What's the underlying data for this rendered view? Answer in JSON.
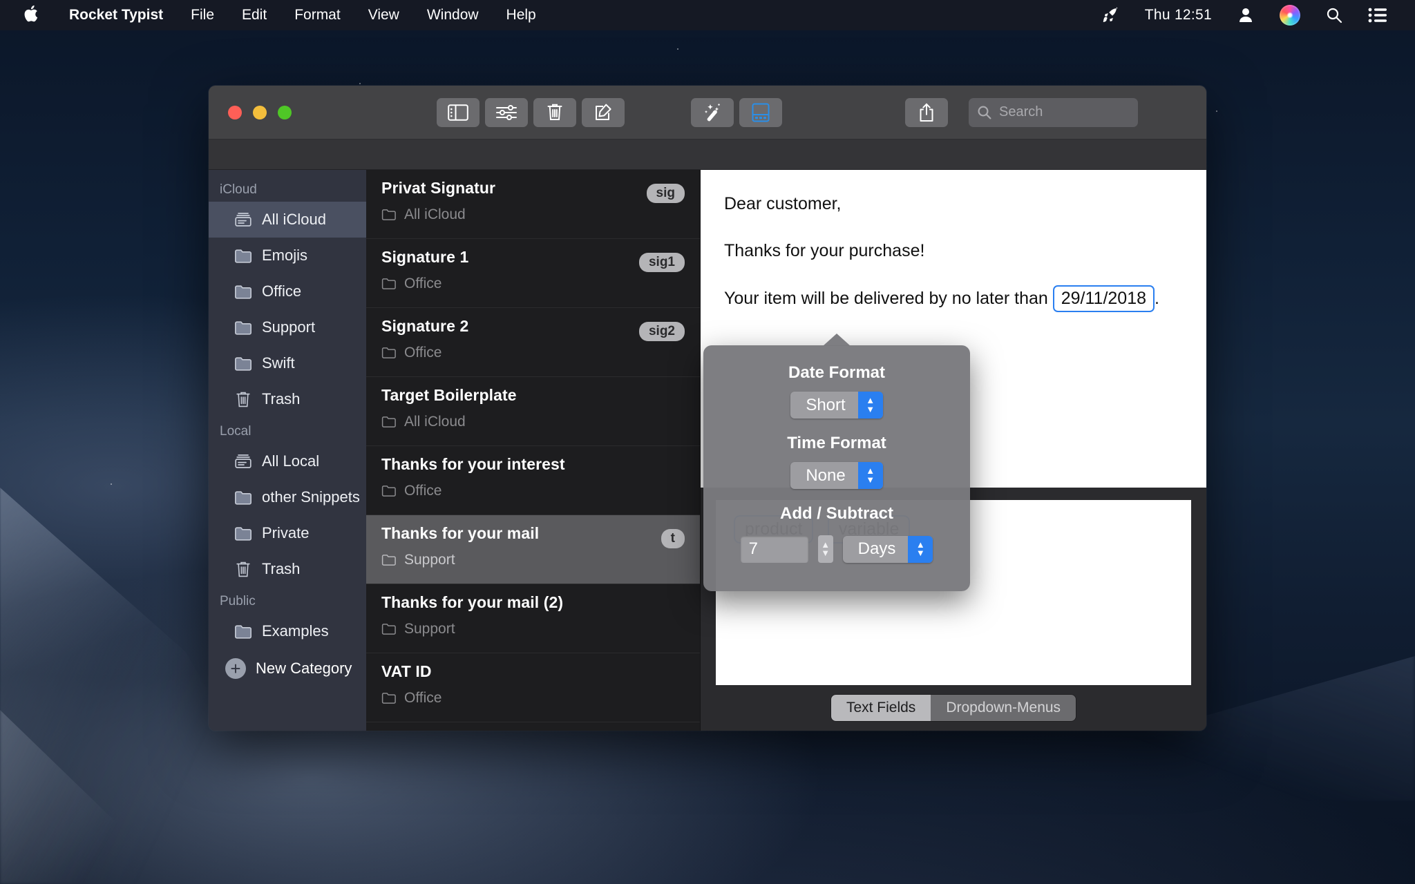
{
  "menubar": {
    "apple_icon": "apple-logo-icon",
    "app_name": "Rocket Typist",
    "items": [
      "File",
      "Edit",
      "Format",
      "View",
      "Window",
      "Help"
    ],
    "status": {
      "rocket_icon": "rocket-icon",
      "clock": "Thu 12:51",
      "user_icon": "user-account-icon",
      "siri_icon": "siri-icon",
      "search_icon": "spotlight-search-icon",
      "control_center_icon": "control-center-icon"
    }
  },
  "window": {
    "toolbar": {
      "buttons": [
        {
          "name": "toggle-sidebar-button",
          "icon": "sidebar-icon"
        },
        {
          "name": "settings-button",
          "icon": "sliders-icon"
        },
        {
          "name": "delete-button",
          "icon": "trash-icon"
        },
        {
          "name": "compose-button",
          "icon": "compose-pencil-icon"
        },
        {
          "name": "magic-button",
          "icon": "magic-wand-icon"
        },
        {
          "name": "form-fields-button",
          "icon": "keyboard-panel-icon"
        },
        {
          "name": "share-button",
          "icon": "share-icon"
        }
      ],
      "search_placeholder": "Search",
      "accent_color": "#2a7ff0"
    },
    "sidebar": {
      "groups": [
        {
          "label": "iCloud",
          "items": [
            {
              "label": "All iCloud",
              "icon": "all-snippets-icon",
              "selected": true
            },
            {
              "label": "Emojis",
              "icon": "folder-icon",
              "selected": false
            },
            {
              "label": "Office",
              "icon": "folder-icon",
              "selected": false
            },
            {
              "label": "Support",
              "icon": "folder-icon",
              "selected": false
            },
            {
              "label": "Swift",
              "icon": "folder-icon",
              "selected": false
            },
            {
              "label": "Trash",
              "icon": "trash-icon",
              "selected": false
            }
          ]
        },
        {
          "label": "Local",
          "items": [
            {
              "label": "All Local",
              "icon": "all-snippets-icon",
              "selected": false
            },
            {
              "label": "other Snippets",
              "icon": "folder-icon",
              "selected": false
            },
            {
              "label": "Private",
              "icon": "folder-icon",
              "selected": false
            },
            {
              "label": "Trash",
              "icon": "trash-icon",
              "selected": false
            }
          ]
        },
        {
          "label": "Public",
          "items": [
            {
              "label": "Examples",
              "icon": "folder-icon",
              "selected": false
            }
          ]
        }
      ],
      "new_category_label": "New Category",
      "new_category_icon": "plus-circle-icon"
    },
    "snippet_list": [
      {
        "title": "Privat Signatur",
        "folder": "All iCloud",
        "abbr": "sig",
        "selected": false
      },
      {
        "title": "Signature 1",
        "folder": "Office",
        "abbr": "sig1",
        "selected": false
      },
      {
        "title": "Signature 2",
        "folder": "Office",
        "abbr": "sig2",
        "selected": false
      },
      {
        "title": "Target Boilerplate",
        "folder": "All iCloud",
        "abbr": "",
        "selected": false
      },
      {
        "title": "Thanks for your interest",
        "folder": "Office",
        "abbr": "",
        "selected": false
      },
      {
        "title": "Thanks for your mail",
        "folder": "Support",
        "abbr": "t",
        "selected": true
      },
      {
        "title": "Thanks for your mail (2)",
        "folder": "Support",
        "abbr": "",
        "selected": false
      },
      {
        "title": "VAT ID",
        "folder": "Office",
        "abbr": "",
        "selected": false
      }
    ],
    "document": {
      "line1": "Dear customer,",
      "line2": "Thanks for your purchase!",
      "line3_prefix": "Your item will be delivered by no later than",
      "date_token": "29/11/2018",
      "line3_suffix": "."
    },
    "fields_panel": {
      "chips": [
        "product",
        "variable"
      ],
      "tabs": [
        {
          "label": "Text Fields",
          "active": true
        },
        {
          "label": "Dropdown-Menus",
          "active": false
        }
      ]
    }
  },
  "popover": {
    "date_format_label": "Date Format",
    "date_format_value": "Short",
    "time_format_label": "Time Format",
    "time_format_value": "None",
    "add_subtract_label": "Add / Subtract",
    "amount_value": "7",
    "unit_value": "Days"
  }
}
